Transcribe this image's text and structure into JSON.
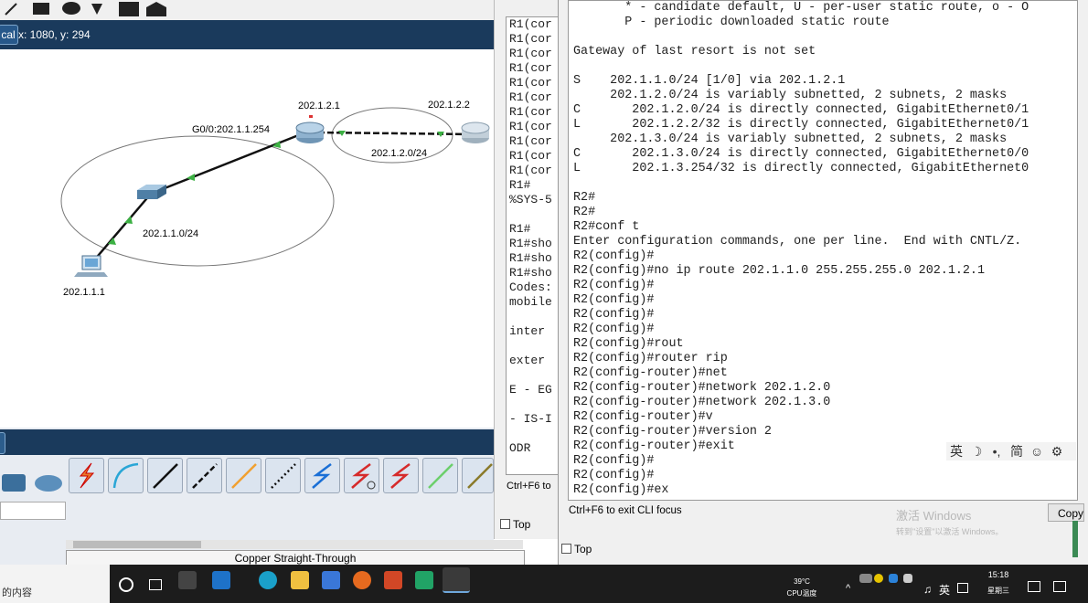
{
  "topology": {
    "mode_tab": "cal",
    "coords": "x: 1080, y: 294",
    "labels": {
      "r1_top": "202.1.2.1",
      "r1_g0": "G0/0:202.1.1.254",
      "r2_top": "202.1.2.2",
      "link_net": "202.1.2.0/24",
      "lan_net": "202.1.1.0/24",
      "pc_ip": "202.1.1.1"
    },
    "cable_label": "Copper Straight-Through"
  },
  "r1_window": {
    "lines": [
      "R1(cor",
      "R1(cor",
      "R1(cor",
      "R1(cor",
      "R1(cor",
      "R1(cor",
      "R1(cor",
      "R1(cor",
      "R1(cor",
      "R1(cor",
      "R1(cor",
      "R1#",
      "%SYS-5",
      "",
      "R1#",
      "R1#sho",
      "R1#sho",
      "R1#sho",
      "Codes:",
      "mobile",
      "",
      "inter",
      "",
      "exter",
      "",
      "E - EG",
      "",
      "- IS-I",
      "",
      "ODR"
    ],
    "footer": "Ctrl+F6 to",
    "top_label": "Top"
  },
  "r2_window": {
    "lines": [
      "       * - candidate default, U - per-user static route, o - O",
      "       P - periodic downloaded static route",
      "",
      "Gateway of last resort is not set",
      "",
      "S    202.1.1.0/24 [1/0] via 202.1.2.1",
      "     202.1.2.0/24 is variably subnetted, 2 subnets, 2 masks",
      "C       202.1.2.0/24 is directly connected, GigabitEthernet0/1",
      "L       202.1.2.2/32 is directly connected, GigabitEthernet0/1",
      "     202.1.3.0/24 is variably subnetted, 2 subnets, 2 masks",
      "C       202.1.3.0/24 is directly connected, GigabitEthernet0/0",
      "L       202.1.3.254/32 is directly connected, GigabitEthernet0",
      "",
      "R2#",
      "R2#",
      "R2#conf t",
      "Enter configuration commands, one per line.  End with CNTL/Z.",
      "R2(config)#",
      "R2(config)#no ip route 202.1.1.0 255.255.255.0 202.1.2.1",
      "R2(config)#",
      "R2(config)#",
      "R2(config)#",
      "R2(config)#",
      "R2(config)#rout",
      "R2(config)#router rip",
      "R2(config-router)#net",
      "R2(config-router)#network 202.1.2.0",
      "R2(config-router)#network 202.1.3.0",
      "R2(config-router)#v",
      "R2(config-router)#version 2",
      "R2(config-router)#exit",
      "R2(config)#",
      "R2(config)#",
      "R2(config)#ex"
    ],
    "footer": "Ctrl+F6 to exit CLI focus",
    "top_label": "Top",
    "copy_label": "Copy",
    "watermark_title": "激活 Windows",
    "watermark_sub": "转到\"设置\"以激活 Windows。",
    "ime": [
      "英",
      "☽",
      "•,",
      "简",
      "☺",
      "⚙"
    ]
  },
  "taskbar": {
    "left_text": "的内容",
    "temp": "39°C",
    "cpu": "CPU温度",
    "ime_lang": "英",
    "time": "15:18",
    "weekday": "星期三"
  },
  "colors": {
    "topology_bar": "#1a3a5c",
    "link": "#1a1a1a",
    "link_dot": "#3cb043",
    "taskbar": "#1c1c1c"
  }
}
